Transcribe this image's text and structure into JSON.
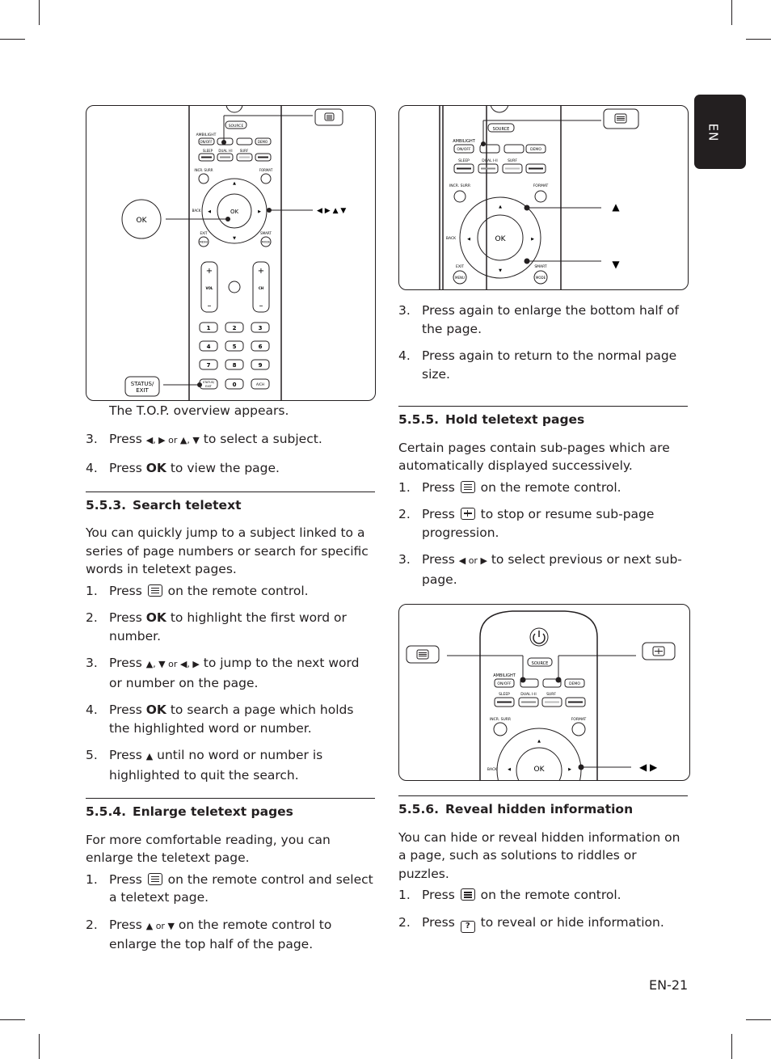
{
  "language_tab": "EN",
  "page_number": "EN-21",
  "figure1": {
    "callout_ok": "OK",
    "callout_status_exit": [
      "STATUS/",
      "EXIT"
    ],
    "callout_arrows": "◀ ▶ ▲ ▼",
    "remote": {
      "source": "SOURCE",
      "ambilight": "AMBILIGHT",
      "onoff": "ON/OFF",
      "demo": "DEMO",
      "sleep": "SLEEP",
      "dual": "DUAL I-II",
      "surf": "SURF",
      "incr_surr": "INCR. SURR",
      "format": "FORMAT",
      "back": "BACK",
      "ok": "OK",
      "exit": "EXIT",
      "menu": "MENU",
      "smart": "SMART",
      "mode": "MODE",
      "vol": "VOL",
      "ch": "CH",
      "plus": "+",
      "minus": "–",
      "digits": [
        "1",
        "2",
        "3",
        "4",
        "5",
        "6",
        "7",
        "8",
        "9"
      ],
      "status_small": "STATUS/ EXIT",
      "zero": "0",
      "ach": "A/CH"
    }
  },
  "figure2": {
    "callout_up": "▲",
    "callout_down": "▼"
  },
  "figure3": {
    "callout_arrows": "◀ ▶"
  },
  "left_column": {
    "intro_line": "The T.O.P. overview appears.",
    "top_steps": [
      {
        "num": "3.",
        "pre": "Press ",
        "sym": "◀, ▶ or ▲, ▼",
        "post": " to select a subject."
      },
      {
        "num": "4.",
        "pre": "Press ",
        "bold": "OK",
        "post": " to view the page."
      }
    ],
    "section_553": {
      "number": "5.5.3.",
      "title": "Search teletext",
      "intro": "You can quickly jump to a subject linked to a series of page numbers or search for specific words in teletext pages.",
      "steps": [
        {
          "num": "1.",
          "pre": "Press ",
          "icon": "teletext",
          "post": " on the remote control."
        },
        {
          "num": "2.",
          "pre": "Press ",
          "bold": "OK",
          "post": " to highlight the first word or number."
        },
        {
          "num": "3.",
          "pre": "Press ",
          "sym": "▲, ▼ or ◀, ▶",
          "post": " to jump to the next word or number on the page."
        },
        {
          "num": "4.",
          "pre": "Press ",
          "bold": "OK",
          "post": " to search a page which holds the highlighted word or number."
        },
        {
          "num": "5.",
          "pre": "Press ",
          "sym": "▲",
          "post": " until no word or number is highlighted to quit the search."
        }
      ]
    },
    "section_554": {
      "number": "5.5.4.",
      "title": "Enlarge teletext pages",
      "intro": "For more comfortable reading, you can enlarge the teletext page.",
      "steps": [
        {
          "num": "1.",
          "pre": "Press ",
          "icon": "teletext",
          "post": " on the remote control and select a teletext page."
        },
        {
          "num": "2.",
          "pre": "Press ",
          "sym": "▲ or ▼",
          "post": " on the remote control to enlarge the top half of the page."
        }
      ]
    }
  },
  "right_column": {
    "enlarge_steps": [
      {
        "num": "3.",
        "text": "Press again to enlarge the bottom half of the page."
      },
      {
        "num": "4.",
        "text": "Press again to return to the normal page size."
      }
    ],
    "section_555": {
      "number": "5.5.5.",
      "title": "Hold teletext pages",
      "intro": "Certain pages contain sub-pages which are automatically displayed successively.",
      "steps": [
        {
          "num": "1.",
          "pre": "Press ",
          "icon": "teletext",
          "post": " on the remote control."
        },
        {
          "num": "2.",
          "pre": "Press ",
          "icon": "hold",
          "post": " to stop or resume sub-page progression."
        },
        {
          "num": "3.",
          "pre": "Press ",
          "sym": "◀ or ▶",
          "post": " to select previous or next sub-page."
        }
      ]
    },
    "section_556": {
      "number": "5.5.6.",
      "title": "Reveal hidden information",
      "intro": "You can hide or reveal hidden information on a page, such as solutions to riddles or puzzles.",
      "steps": [
        {
          "num": "1.",
          "pre": "Press ",
          "icon": "teletext",
          "post": " on the remote control."
        },
        {
          "num": "2.",
          "pre": "Press ",
          "icon": "reveal",
          "post": " to reveal or hide information."
        }
      ]
    }
  }
}
